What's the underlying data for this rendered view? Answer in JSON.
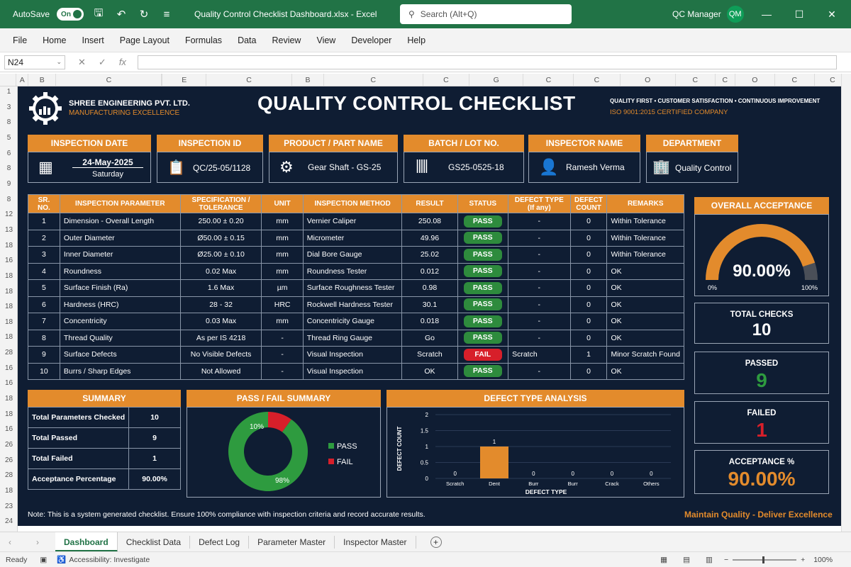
{
  "titlebar": {
    "autosave_label": "AutoSave",
    "autosave_state": "On",
    "doc_title": "Quality Control Checklist Dashboard.xlsx  -  Excel",
    "search_placeholder": "Search (Alt+Q)",
    "user_name": "QC Manager",
    "user_initials": "QM"
  },
  "ribbon": [
    "File",
    "Home",
    "Insert",
    "Page Layout",
    "Formulas",
    "Data",
    "Review",
    "View",
    "Developer",
    "Help"
  ],
  "formula_bar": {
    "cell_ref": "N24"
  },
  "column_headers": [
    "A",
    "B",
    "C",
    "E",
    "C",
    "B",
    "C",
    "C",
    "G",
    "C",
    "C",
    "O",
    "C",
    "C",
    "O",
    "C",
    "C"
  ],
  "row_numbers": [
    "1",
    "3",
    "8",
    "5",
    "6",
    "8",
    "9",
    "8",
    "12",
    "13",
    "18",
    "16",
    "18",
    "18",
    "18",
    "18",
    "18",
    "28",
    "16",
    "16",
    "18",
    "18",
    "16",
    "26",
    "26",
    "28",
    "18",
    "23",
    "24"
  ],
  "company": {
    "name": "SHREE ENGINEERING PVT. LTD.",
    "tagline": "MANUFACTURING EXCELLENCE"
  },
  "main_title": "QUALITY CONTROL CHECKLIST",
  "mottos": {
    "line1": "QUALITY FIRST  •  CUSTOMER SATISFACTION  •  CONTINUOUS IMPROVEMENT",
    "line2": "ISO 9001:2015 CERTIFIED COMPANY"
  },
  "info": {
    "date_label": "INSPECTION DATE",
    "date_value": "24-May-2025",
    "date_day": "Saturday",
    "id_label": "INSPECTION ID",
    "id_value": "QC/25-05/1128",
    "product_label": "PRODUCT / PART NAME",
    "product_value": "Gear Shaft - GS-25",
    "batch_label": "BATCH / LOT NO.",
    "batch_value": "GS25-0525-18",
    "inspector_label": "INSPECTOR NAME",
    "inspector_value": "Ramesh Verma",
    "dept_label": "DEPARTMENT",
    "dept_value": "Quality Control"
  },
  "table": {
    "headers": [
      "SR. NO.",
      "INSPECTION PARAMETER",
      "SPECIFICATION / TOLERANCE",
      "UNIT",
      "INSPECTION METHOD",
      "RESULT",
      "STATUS",
      "DEFECT TYPE (If any)",
      "DEFECT COUNT",
      "REMARKS"
    ],
    "rows": [
      [
        "1",
        "Dimension - Overall Length",
        "250.00 ± 0.20",
        "mm",
        "Vernier Caliper",
        "250.08",
        "PASS",
        "-",
        "0",
        "Within Tolerance"
      ],
      [
        "2",
        "Outer Diameter",
        "Ø50.00 ± 0.15",
        "mm",
        "Micrometer",
        "49.96",
        "PASS",
        "-",
        "0",
        "Within Tolerance"
      ],
      [
        "3",
        "Inner Diameter",
        "Ø25.00 ± 0.10",
        "mm",
        "Dial Bore Gauge",
        "25.02",
        "PASS",
        "-",
        "0",
        "Within Tolerance"
      ],
      [
        "4",
        "Roundness",
        "0.02 Max",
        "mm",
        "Roundness Tester",
        "0.012",
        "PASS",
        "-",
        "0",
        "OK"
      ],
      [
        "5",
        "Surface Finish (Ra)",
        "1.6 Max",
        "µm",
        "Surface Roughness Tester",
        "0.98",
        "PASS",
        "-",
        "0",
        "OK"
      ],
      [
        "6",
        "Hardness (HRC)",
        "28 - 32",
        "HRC",
        "Rockwell Hardness Tester",
        "30.1",
        "PASS",
        "-",
        "0",
        "OK"
      ],
      [
        "7",
        "Concentricity",
        "0.03 Max",
        "mm",
        "Concentricity Gauge",
        "0.018",
        "PASS",
        "-",
        "0",
        "OK"
      ],
      [
        "8",
        "Thread Quality",
        "As per IS 4218",
        "-",
        "Thread Ring Gauge",
        "Go",
        "PASS",
        "-",
        "0",
        "OK"
      ],
      [
        "9",
        "Surface Defects",
        "No Visible Defects",
        "-",
        "Visual Inspection",
        "Scratch",
        "FAIL",
        "Scratch",
        "1",
        "Minor Scratch Found"
      ],
      [
        "10",
        "Burrs / Sharp Edges",
        "Not Allowed",
        "-",
        "Visual Inspection",
        "OK",
        "PASS",
        "-",
        "0",
        "OK"
      ]
    ]
  },
  "overall": {
    "label": "OVERALL ACCEPTANCE",
    "value_text": "90.00%",
    "value": 0.9,
    "min_label": "0%",
    "max_label": "100%"
  },
  "cards": {
    "total_label": "TOTAL CHECKS",
    "total_value": "10",
    "passed_label": "PASSED",
    "passed_value": "9",
    "failed_label": "FAILED",
    "failed_value": "1",
    "acc_label": "ACCEPTANCE %",
    "acc_value": "90.00%"
  },
  "summary": {
    "title": "SUMMARY",
    "rows": [
      [
        "Total Parameters Checked",
        "10"
      ],
      [
        "Total Passed",
        "9"
      ],
      [
        "Total Failed",
        "1"
      ],
      [
        "Acceptance Percentage",
        "90.00%"
      ]
    ]
  },
  "pie": {
    "title": "PASS / FAIL SUMMARY",
    "fail_label": "10%",
    "pass_label": "98%",
    "legend_pass": "PASS",
    "legend_fail": "FAIL",
    "pass_color": "#2e9b3f",
    "fail_color": "#d71f2a"
  },
  "chart_data": {
    "type": "bar",
    "title": "DEFECT TYPE ANALYSIS",
    "xlabel": "DEFECT TYPE",
    "ylabel": "DEFECT COUNT",
    "categories": [
      "Scratch",
      "Dent",
      "Burr",
      "Burr",
      "Crack",
      "Others"
    ],
    "values": [
      0,
      1,
      0,
      0,
      0,
      0
    ],
    "ylim": [
      0,
      2
    ],
    "yticks": [
      "0",
      "0.5",
      "1",
      "1.5",
      "2"
    ],
    "bar_color": "#e38b2c"
  },
  "footer": {
    "note": "Note: This is a system generated checklist. Ensure 100% compliance with inspection criteria and record accurate results.",
    "slogan": "Maintain Quality - Deliver Excellence"
  },
  "sheet_tabs": [
    "Dashboard",
    "Checklist Data",
    "Defect Log",
    "Parameter Master",
    "Inspector Master"
  ],
  "status": {
    "ready": "Ready",
    "accessibility": "Accessibility: Investigate",
    "zoom": "100%"
  },
  "colors": {
    "accent": "#e38b2c",
    "background": "#0f1d33",
    "excel_green": "#217346"
  }
}
